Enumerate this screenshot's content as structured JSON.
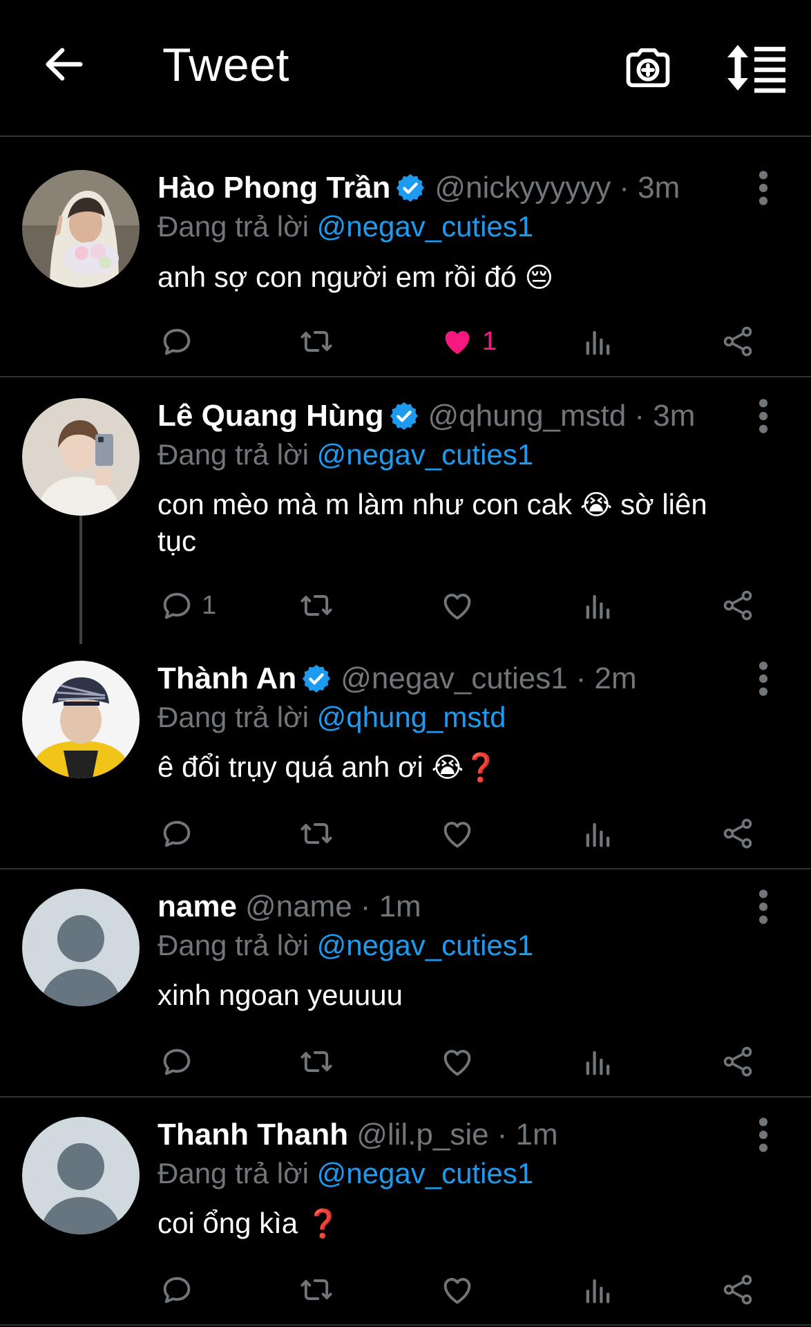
{
  "header": {
    "title": "Tweet"
  },
  "reply_prefix": "Đang trả lời",
  "tweets": [
    {
      "name": "Hào Phong Trần",
      "verified": true,
      "handle": "@nickyyyyyy",
      "time": "· 3m",
      "reply_to": "@negav_cuties1",
      "text": "anh sợ con người em rồi đó",
      "emoji": "😔",
      "reply_count": "",
      "like_count": "1",
      "liked": true
    },
    {
      "name": "Lê Quang Hùng",
      "verified": true,
      "handle": "@qhung_mstd",
      "time": "· 3m",
      "reply_to": "@negav_cuties1",
      "text_a": "con mèo mà m làm như con cak",
      "emoji": "😭",
      "text_b": "sờ liên",
      "text_c": "tục",
      "reply_count": "1",
      "like_count": "",
      "liked": false
    },
    {
      "name": "Thành An",
      "verified": true,
      "handle": "@negav_cuties1",
      "time": "· 2m",
      "reply_to": "@qhung_mstd",
      "text": "ê đổi trụy quá anh ơi",
      "emoji": "😭❓",
      "reply_count": "",
      "like_count": "",
      "liked": false
    },
    {
      "name": "name",
      "verified": false,
      "handle": "@name",
      "time": "· 1m",
      "reply_to": "@negav_cuties1",
      "text": "xinh ngoan yeuuuu",
      "emoji": "",
      "reply_count": "",
      "like_count": "",
      "liked": false
    },
    {
      "name": "Thanh Thanh",
      "verified": false,
      "handle": "@lil.p_sie",
      "time": "· 1m",
      "reply_to": "@negav_cuties1",
      "text": "coi ổng kìa",
      "emoji": "❓",
      "reply_count": "",
      "like_count": "",
      "liked": false
    }
  ],
  "colors": {
    "background": "#000000",
    "accent_blue": "#1d9bf0",
    "muted": "#71767b",
    "like_pink": "#f91880",
    "divider": "#2f3336"
  },
  "icons": [
    "back-arrow-icon",
    "camera-plus-icon",
    "sort-list-icon",
    "verified-badge-icon",
    "more-vertical-icon",
    "reply-icon",
    "retweet-icon",
    "like-icon",
    "analytics-icon",
    "share-icon"
  ]
}
